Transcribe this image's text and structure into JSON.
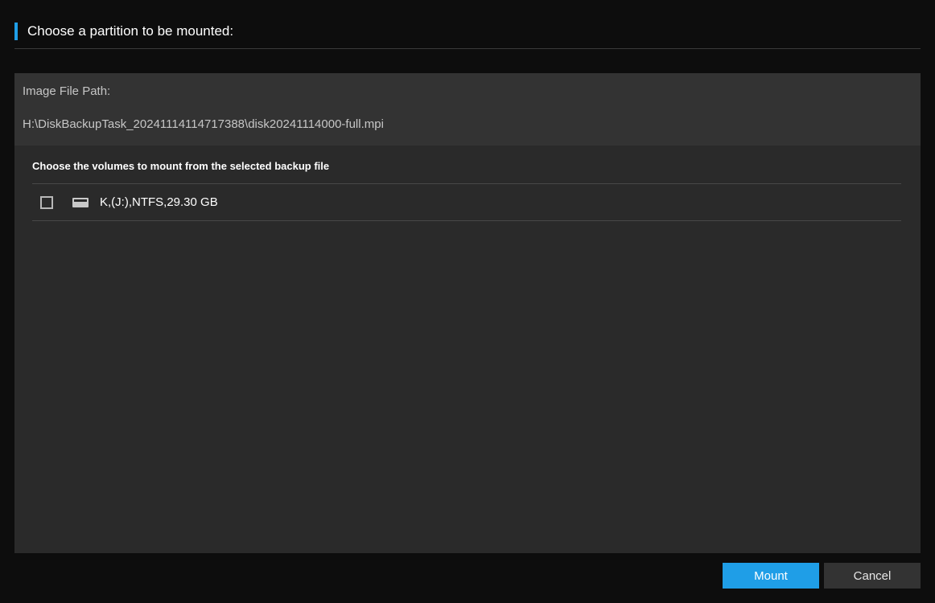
{
  "header": {
    "title": "Choose a partition to be mounted:"
  },
  "info": {
    "label": "Image File Path:",
    "path": "H:\\DiskBackupTask_20241114114717388\\disk20241114000-full.mpi"
  },
  "list": {
    "header": "Choose the volumes to mount from the selected backup file",
    "volumes": [
      {
        "label": "K,(J:),NTFS,29.30 GB",
        "checked": false
      }
    ]
  },
  "footer": {
    "mount": "Mount",
    "cancel": "Cancel"
  }
}
